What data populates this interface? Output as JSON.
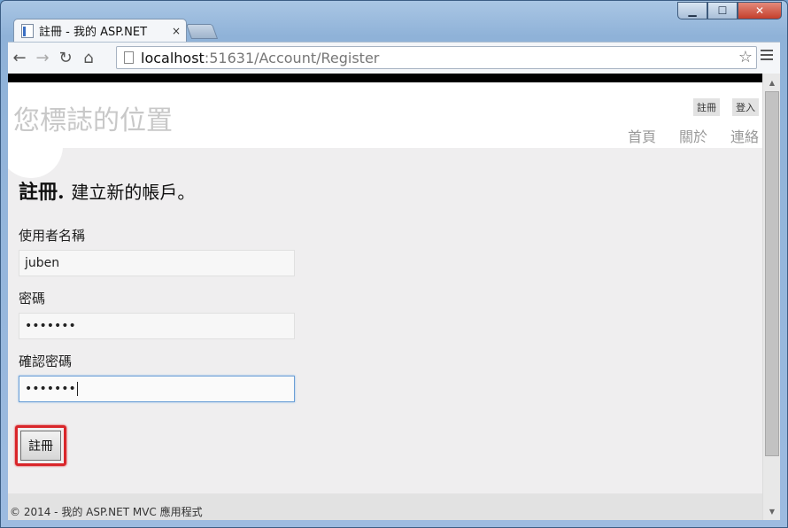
{
  "browser": {
    "tab_title": "註冊 - 我的 ASP.NET",
    "tab_close": "×",
    "url_host": "localhost",
    "url_rest": ":51631/Account/Register",
    "back_glyph": "←",
    "forward_glyph": "→",
    "reload_glyph": "↻",
    "home_glyph": "⌂",
    "star_glyph": "☆",
    "win_min": "▁",
    "win_max": "☐",
    "win_close": "✕"
  },
  "header": {
    "logo": "您標誌的位置",
    "login_links": [
      {
        "label": "註冊"
      },
      {
        "label": "登入"
      }
    ],
    "menu": [
      {
        "label": "首頁"
      },
      {
        "label": "關於"
      },
      {
        "label": "連絡"
      }
    ]
  },
  "form": {
    "title": "註冊.",
    "subtitle": "建立新的帳戶。",
    "username_label": "使用者名稱",
    "username_value": "juben",
    "password_label": "密碼",
    "password_value": "•••••••",
    "confirm_label": "確認密碼",
    "confirm_value": "•••••••",
    "submit_label": "註冊"
  },
  "footer": {
    "text": "© 2014 - 我的 ASP.NET MVC 應用程式"
  },
  "scrollbar": {
    "up_glyph": "▲",
    "down_glyph": "▼"
  }
}
